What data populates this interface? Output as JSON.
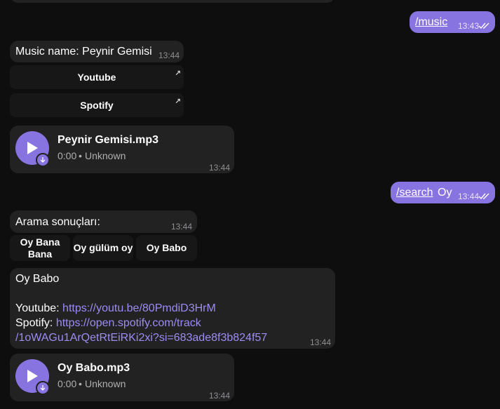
{
  "out1": {
    "command": "/music",
    "time": "13:43"
  },
  "music_msg": {
    "text": "Music name: Peynir Gemisi",
    "time": "13:44",
    "buttons": [
      "Youtube",
      "Spotify"
    ]
  },
  "audio1": {
    "filename": "Peynir Gemisi.mp3",
    "duration": "0:00",
    "sep": "•",
    "artist": "Unknown",
    "time": "13:44"
  },
  "out2": {
    "command": "/search",
    "arg": "Oy",
    "time": "13:44"
  },
  "search_msg": {
    "text": "Arama sonuçları:",
    "time": "13:44",
    "buttons": [
      "Oy Bana Bana",
      "Oy gülüm oy",
      "Oy Babo"
    ]
  },
  "result_msg": {
    "title": "Oy Babo",
    "youtube_label": "Youtube:",
    "youtube_url": "https://youtu.be/80PmdiD3HrM",
    "spotify_label": "Spotify:",
    "spotify_url_line1": "https://open.spotify.com/track",
    "spotify_url_line2": "/1oWAGu1ArQetRtEiRKi2xi?si=683ade8f3b824f57",
    "time": "13:44"
  },
  "audio2": {
    "filename": "Oy Babo.mp3",
    "duration": "0:00",
    "sep": "•",
    "artist": "Unknown",
    "time": "13:44"
  },
  "icons": {
    "play": "play-icon",
    "download": "download-arrow-icon",
    "read": "double-check-icon",
    "external": "external-link-icon"
  },
  "colors": {
    "accent": "#8774e1",
    "bubble": "#222222",
    "background": "#0e0e0e",
    "link": "#9c8cf5"
  }
}
